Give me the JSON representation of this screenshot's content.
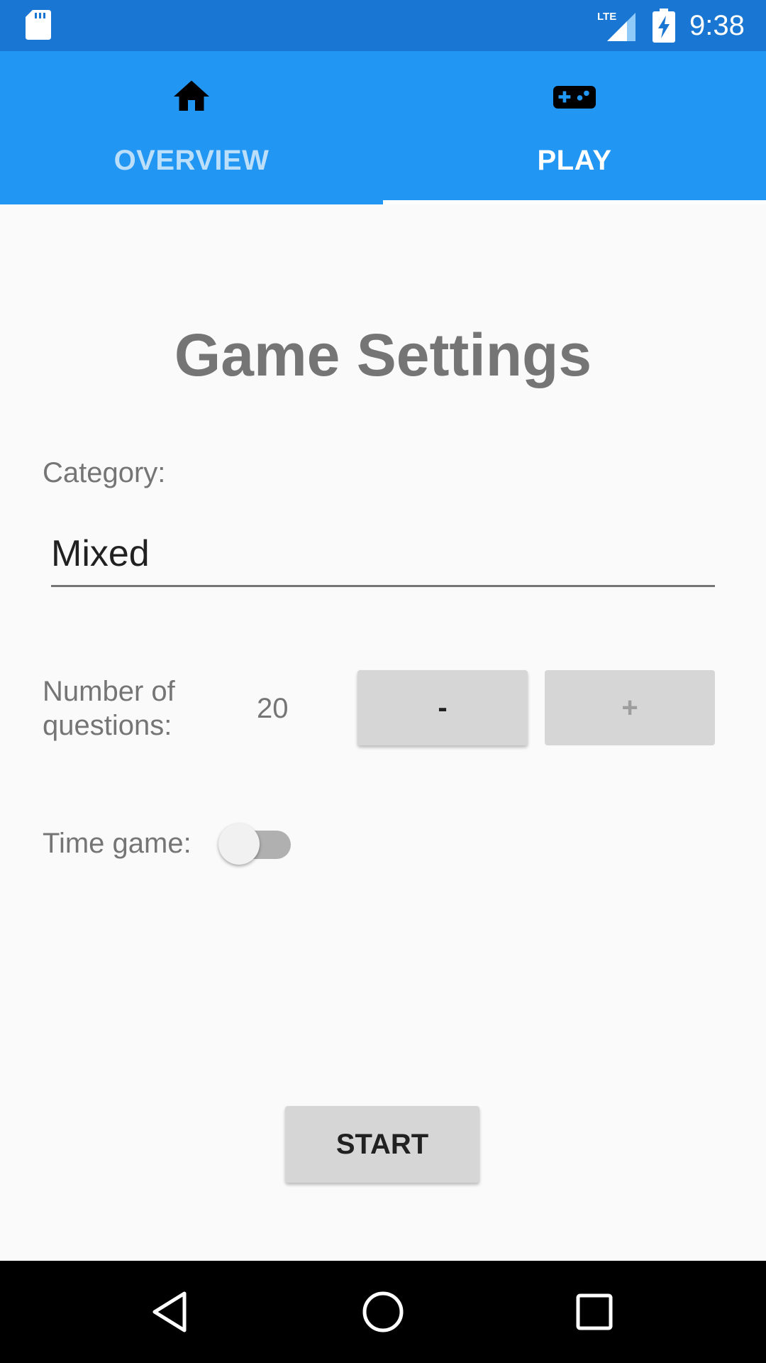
{
  "status_bar": {
    "time": "9:38",
    "network": "LTE",
    "icons": [
      "sd-card-icon",
      "lte-signal-icon",
      "battery-charging-icon"
    ]
  },
  "tabs": [
    {
      "label": "OVERVIEW",
      "icon": "home-icon",
      "selected": false
    },
    {
      "label": "PLAY",
      "icon": "gamepad-icon",
      "selected": true
    }
  ],
  "main": {
    "title": "Game Settings",
    "category_label": "Category:",
    "category_value": "Mixed",
    "questions_label": "Number of questions:",
    "questions_count": "20",
    "minus_label": "-",
    "plus_label": "+",
    "time_game_label": "Time game:",
    "time_game_on": false,
    "start_label": "START"
  },
  "nav_bar": {
    "icons": [
      "back-icon",
      "home-circle-icon",
      "recent-apps-icon"
    ]
  },
  "colors": {
    "status_bar": "#1976d2",
    "tab_bar": "#2196f3",
    "background": "#fafafa",
    "button": "#d6d6d6",
    "text_muted": "#757575"
  }
}
